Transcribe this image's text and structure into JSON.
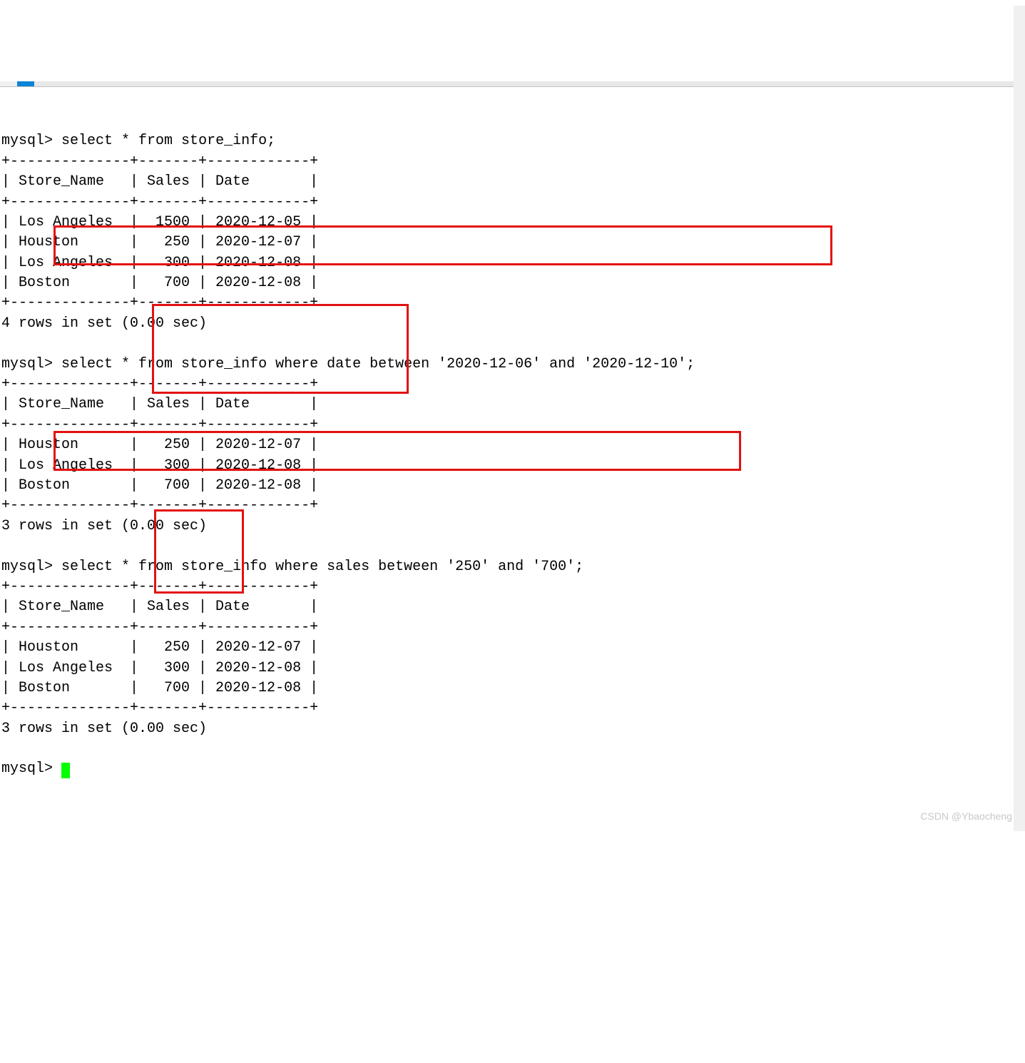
{
  "tabs": {
    "inactive_label": "",
    "active_label": ""
  },
  "prompt": "mysql>",
  "queries": {
    "q1": "select * from store_info;",
    "q2": "select * from store_info where date between '2020-12-06' and '2020-12-10';",
    "q3": "select * from store_info where sales between '250' and '700';"
  },
  "separators": {
    "top": "+--------------+-------+------------+",
    "header": "| Store_Name   | Sales | Date       |",
    "mid": "+--------------+-------+------------+",
    "bot": "+--------------+-------+------------+"
  },
  "rows": {
    "r_la_1500": "| Los Angeles  |  1500 | 2020-12-05 |",
    "r_hou_250": "| Houston      |   250 | 2020-12-07 |",
    "r_la_300": "| Los Angeles  |   300 | 2020-12-08 |",
    "r_bos_700": "| Boston       |   700 | 2020-12-08 |"
  },
  "summaries": {
    "s4": "4 rows in set (0.00 sec)",
    "s3": "3 rows in set (0.00 sec)"
  },
  "watermark": "CSDN @Ybaocheng"
}
